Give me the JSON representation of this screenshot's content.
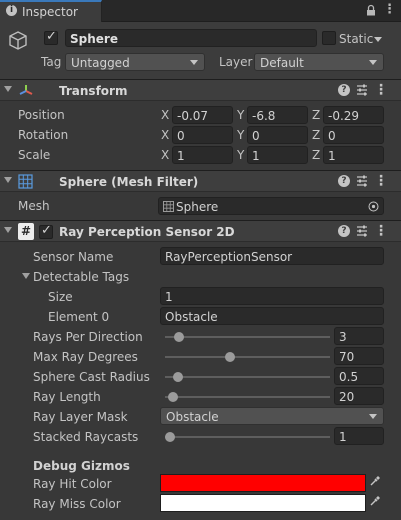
{
  "tab": {
    "label": "Inspector",
    "icon": "info-icon"
  },
  "window_controls": {
    "lock_icon": "lock-icon",
    "menu_icon": "kebab-menu-icon"
  },
  "gameobject": {
    "active": true,
    "name": "Sphere",
    "static_label": "Static",
    "static_checked": false,
    "tag_label": "Tag",
    "tag_value": "Untagged",
    "layer_label": "Layer",
    "layer_value": "Default"
  },
  "transform": {
    "title": "Transform",
    "position": {
      "label": "Position",
      "x": "-0.07",
      "y": "-6.8",
      "z": "-0.29"
    },
    "rotation": {
      "label": "Rotation",
      "x": "0",
      "y": "0",
      "z": "0"
    },
    "scale": {
      "label": "Scale",
      "x": "1",
      "y": "1",
      "z": "1"
    },
    "axes": {
      "x": "X",
      "y": "Y",
      "z": "Z"
    }
  },
  "mesh_filter": {
    "title": "Sphere (Mesh Filter)",
    "mesh_label": "Mesh",
    "mesh_value": "Sphere"
  },
  "ray_sensor": {
    "title": "Ray Perception Sensor 2D",
    "enabled": true,
    "sensor_name_label": "Sensor Name",
    "sensor_name_value": "RayPerceptionSensor",
    "detectable_tags_label": "Detectable Tags",
    "size_label": "Size",
    "size_value": "1",
    "element0_label": "Element 0",
    "element0_value": "Obstacle",
    "rays_per_direction": {
      "label": "Rays Per Direction",
      "value": "3",
      "fraction": 0.06
    },
    "max_ray_degrees": {
      "label": "Max Ray Degrees",
      "value": "70",
      "fraction": 0.39
    },
    "sphere_cast_radius": {
      "label": "Sphere Cast Radius",
      "value": "0.5",
      "fraction": 0.05
    },
    "ray_length": {
      "label": "Ray Length",
      "value": "20",
      "fraction": 0.02
    },
    "ray_layer_mask": {
      "label": "Ray Layer Mask",
      "value": "Obstacle"
    },
    "stacked_raycasts": {
      "label": "Stacked Raycasts",
      "value": "1",
      "fraction": 0.0
    },
    "debug_gizmos_label": "Debug Gizmos",
    "ray_hit_color": {
      "label": "Ray Hit Color",
      "color": "#ff0000"
    },
    "ray_miss_color": {
      "label": "Ray Miss Color",
      "color": "#ffffff"
    }
  }
}
